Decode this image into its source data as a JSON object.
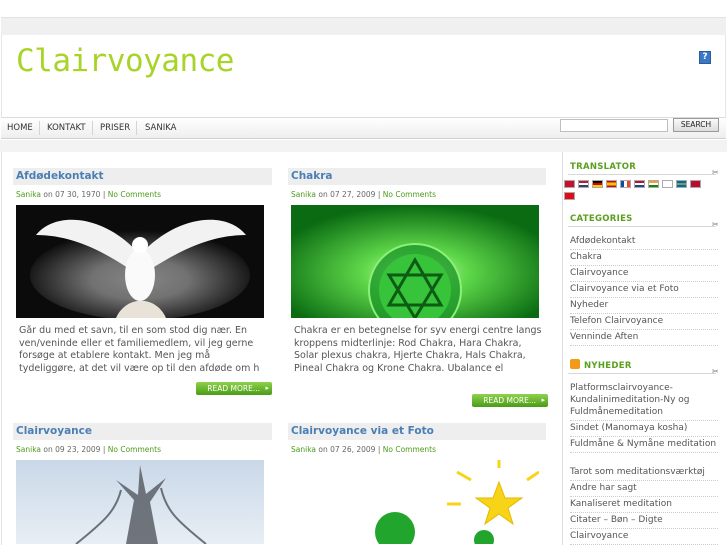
{
  "site": {
    "logo": "Clairvoyance"
  },
  "nav": [
    "HOME",
    "KONTAKT",
    "PRISER",
    "SANIKA"
  ],
  "search": {
    "button": "SEARCH"
  },
  "posts": [
    {
      "title": "Afdødekontakt",
      "author": "Sanika",
      "date": " on 07 30, 1970 | ",
      "comments": "No Comments",
      "excerpt": "Går du med et savn, til en som stod dig nær. En ven/veninde eller et familiemedlem, vil jeg gerne forsøge at etablere kontakt. Men jeg må tydeliggøre, at det vil være op til den afdøde om h",
      "readmore": "READ MORE..."
    },
    {
      "title": "Chakra",
      "author": "Sanika",
      "date": " on 07 27, 2009 | ",
      "comments": "No Comments",
      "excerpt": "Chakra er en betegnelse for syv energi centre langs kroppens midterlinje: Rod Chakra, Hara Chakra, Solar plexus chakra, Hjerte Chakra, Hals Chakra, Pineal Chakra og Krone Chakra. Ubalance el",
      "readmore": "READ MORE..."
    },
    {
      "title": "Clairvoyance",
      "author": "Sanika",
      "date": " on 09 23, 2009 | ",
      "comments": "No Comments"
    },
    {
      "title": "Clairvoyance via et Foto",
      "author": "Sanika",
      "date": " on 07 26, 2009 | ",
      "comments": "No Comments"
    }
  ],
  "sidebar": {
    "translator": "TRANSLATOR",
    "categories_title": "CATEGORIES",
    "categories": [
      "Afdødekontakt",
      "Chakra",
      "Clairvoyance",
      "Clairvoyance via et Foto",
      "Nyheder",
      "Telefon Clairvoyance",
      "Venninde Aften"
    ],
    "news_title": "NYHEDER",
    "news": [
      "Platformsclairvoyance-Kundalinimeditation-Ny og Fuldmånemeditation",
      "Sindet (Manomaya kosha)",
      "Fuldmåne & Nymåne meditation",
      "Tarot som meditationsværktøj",
      "Andre har sagt",
      "Kanaliseret meditation",
      "Citater – Bøn – Digte",
      "Clairvoyance"
    ]
  },
  "colors": {
    "accent_green": "#a8d42a",
    "link_blue": "#4a7fb5",
    "header_green": "#5aa01e"
  }
}
